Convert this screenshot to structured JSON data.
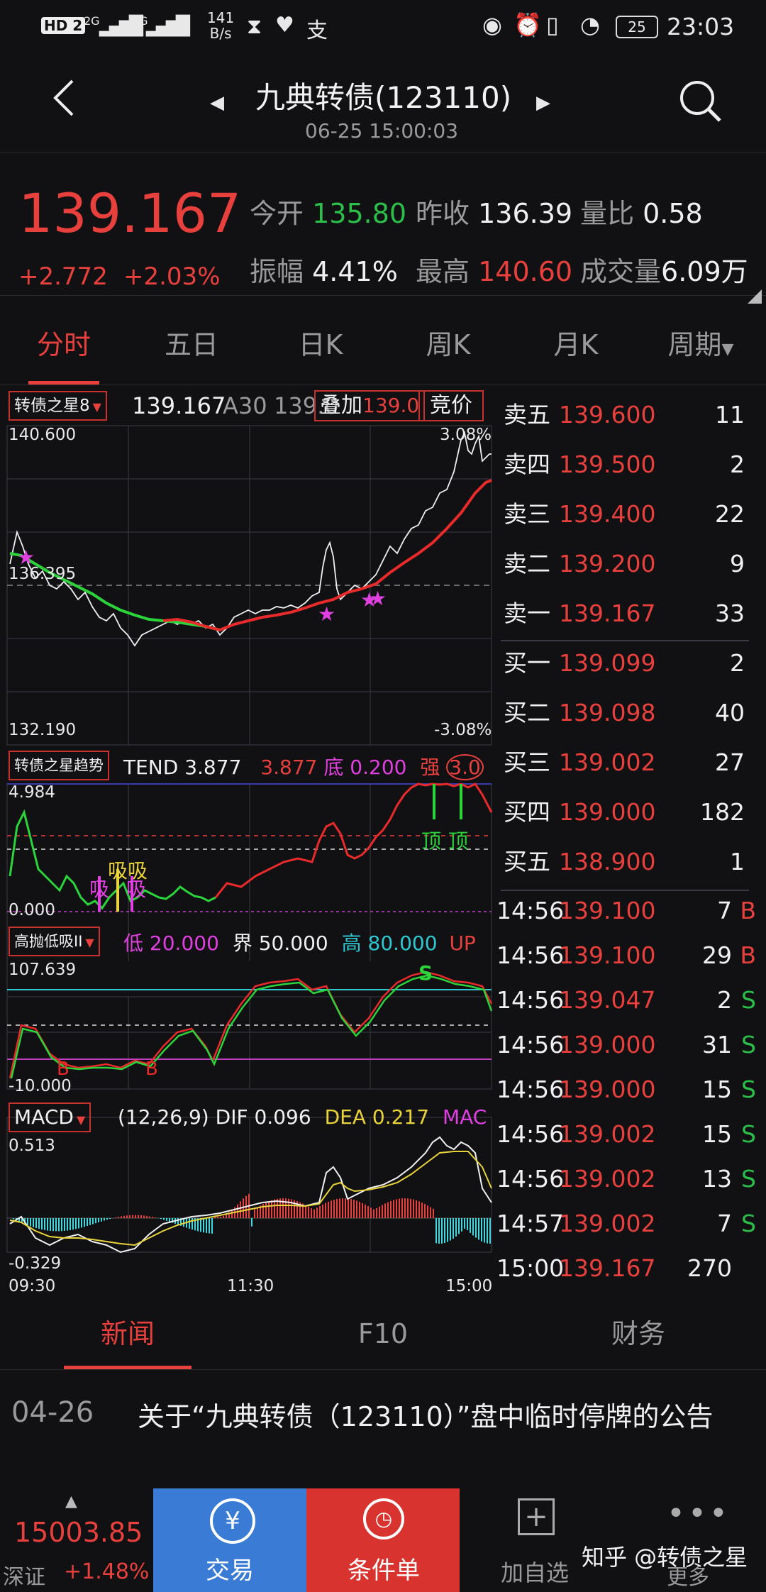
{
  "statusbar": {
    "left_icons": [
      "HD 2",
      "2G",
      "4G"
    ],
    "speed": "141",
    "speed_unit": "B/s",
    "battery": "25",
    "time": "23:03"
  },
  "header": {
    "title": "九典转债(123110)",
    "timestamp": "06-25 15:00:03"
  },
  "quote": {
    "price": "139.167",
    "change": "+2.772",
    "change_pct": "+2.03%",
    "open_label": "今开",
    "open_value": "135.80",
    "prev_label": "昨收",
    "prev_value": "136.39",
    "vr_label": "量比",
    "vr_value": "0.58",
    "amp_label": "振幅",
    "amp_value": "4.41%",
    "high_label": "最高",
    "high_value": "140.60",
    "vol_label": "成交量",
    "vol_value": "6.09万"
  },
  "tabs": [
    "分时",
    "五日",
    "日K",
    "周K",
    "月K",
    "周期"
  ],
  "main_chart": {
    "indicator_label": "转债之星8",
    "price": "139.167",
    "a30_label": "A30",
    "a30_value": "139.0",
    "overlay_label": "叠加",
    "overlay_value": "139.0",
    "auction_label": "竞价",
    "y_top": "140.600",
    "y_mid": "136.395",
    "y_bottom": "132.190",
    "pct_top": "3.08%",
    "pct_bottom": "-3.08%"
  },
  "trend_panel": {
    "label": "转债之星趋势",
    "tend_label": "TEND",
    "tend_value": "3.877",
    "tend_value2": "3.877",
    "di_label": "底",
    "di_value": "0.200",
    "qiang_label": "强",
    "qiang_value": "3.0",
    "y_top": "4.984",
    "y_bottom": "0.000",
    "xi_marks": [
      "吸",
      "吸吸",
      "吸"
    ],
    "ding_marks": [
      "顶",
      "顶"
    ]
  },
  "gaopao_panel": {
    "label": "高抛低吸II",
    "low_label": "低",
    "low_value": "20.000",
    "jie_label": "界",
    "jie_value": "50.000",
    "high_label": "高",
    "high_value": "80.000",
    "up_label": "UP",
    "y_top": "107.639",
    "y_bottom": "-10.000",
    "b_marks": [
      "B",
      "B"
    ],
    "s_mark": "S"
  },
  "macd_panel": {
    "label": "MACD",
    "params": "(12,26,9)",
    "dif_label": "DIF",
    "dif_value": "0.096",
    "dea_label": "DEA",
    "dea_value": "0.217",
    "mac_label": "MAC",
    "y_top": "0.513",
    "y_bottom": "-0.329",
    "x_labels": [
      "09:30",
      "11:30",
      "15:00"
    ]
  },
  "order_book": {
    "asks": [
      {
        "label": "卖五",
        "price": "139.600",
        "qty": "11"
      },
      {
        "label": "卖四",
        "price": "139.500",
        "qty": "2"
      },
      {
        "label": "卖三",
        "price": "139.400",
        "qty": "22"
      },
      {
        "label": "卖二",
        "price": "139.200",
        "qty": "9"
      },
      {
        "label": "卖一",
        "price": "139.167",
        "qty": "33"
      }
    ],
    "bids": [
      {
        "label": "买一",
        "price": "139.099",
        "qty": "2"
      },
      {
        "label": "买二",
        "price": "139.098",
        "qty": "40"
      },
      {
        "label": "买三",
        "price": "139.002",
        "qty": "27"
      },
      {
        "label": "买四",
        "price": "139.000",
        "qty": "182"
      },
      {
        "label": "买五",
        "price": "138.900",
        "qty": "1"
      }
    ]
  },
  "trades": [
    {
      "time": "14:56",
      "price": "139.100",
      "vol": "7",
      "side": "B"
    },
    {
      "time": "14:56",
      "price": "139.100",
      "vol": "29",
      "side": "B"
    },
    {
      "time": "14:56",
      "price": "139.047",
      "vol": "2",
      "side": "S"
    },
    {
      "time": "14:56",
      "price": "139.000",
      "vol": "31",
      "side": "S"
    },
    {
      "time": "14:56",
      "price": "139.000",
      "vol": "15",
      "side": "S"
    },
    {
      "time": "14:56",
      "price": "139.002",
      "vol": "15",
      "side": "S"
    },
    {
      "time": "14:56",
      "price": "139.002",
      "vol": "13",
      "side": "S"
    },
    {
      "time": "14:57",
      "price": "139.002",
      "vol": "7",
      "side": "S"
    },
    {
      "time": "15:00",
      "price": "139.167",
      "vol": "270",
      "side": ""
    }
  ],
  "news_tabs": [
    "新闻",
    "F10",
    "财务"
  ],
  "news": [
    {
      "date": "04-26",
      "title": "关于“九典转债（123110）”盘中临时停牌的公告"
    }
  ],
  "bottom": {
    "index_value": "15003.85",
    "index_name": "深证",
    "index_change": "+1.48%",
    "trade_label": "交易",
    "condition_label": "条件单",
    "add_label": "加自选",
    "more_label": "更多",
    "watermark": "知乎 @转债之星"
  },
  "colors": {
    "up": "#e8403c",
    "down": "#2bbf4a",
    "trade_button": "#3a7bd5",
    "condition_button": "#d9332f"
  }
}
